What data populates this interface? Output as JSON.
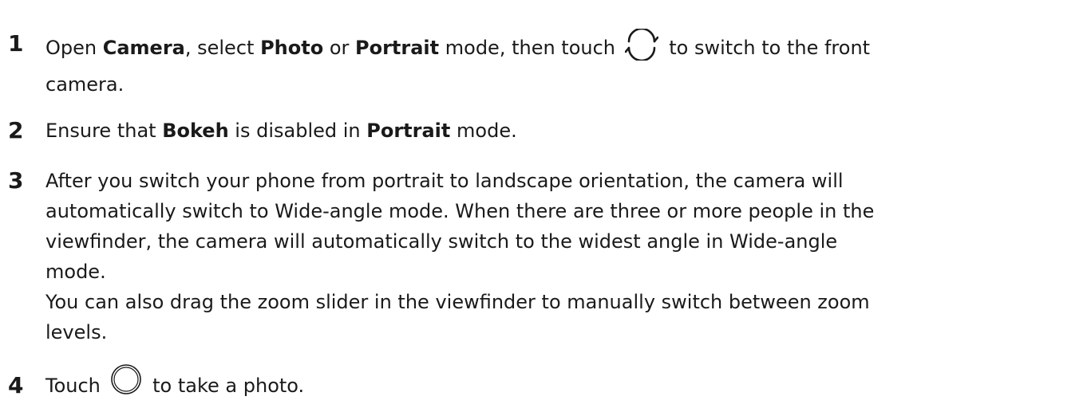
{
  "steps": [
    {
      "number": "1",
      "t1": "Open ",
      "b1": "Camera",
      "t2": ", select ",
      "b2": "Photo",
      "t3": " or ",
      "b3": "Portrait",
      "t4": " mode, then touch ",
      "icon": "switch-camera-icon",
      "t5": " to switch to the front",
      "t6": "camera."
    },
    {
      "number": "2",
      "t1": "Ensure that ",
      "b1": "Bokeh",
      "t2": " is disabled in ",
      "b2": "Portrait",
      "t3": " mode."
    },
    {
      "number": "3",
      "lines": [
        "After you switch your phone from portrait to landscape orientation, the camera will",
        "automatically switch to Wide-angle mode. When there are three or more people in the",
        "viewfinder, the camera will automatically switch to the widest angle in Wide-angle",
        "mode.",
        "You can also drag the zoom slider in the viewfinder to manually switch between zoom",
        "levels."
      ]
    },
    {
      "number": "4",
      "t1": "Touch ",
      "icon": "shutter-icon",
      "t2": " to take a photo."
    }
  ]
}
